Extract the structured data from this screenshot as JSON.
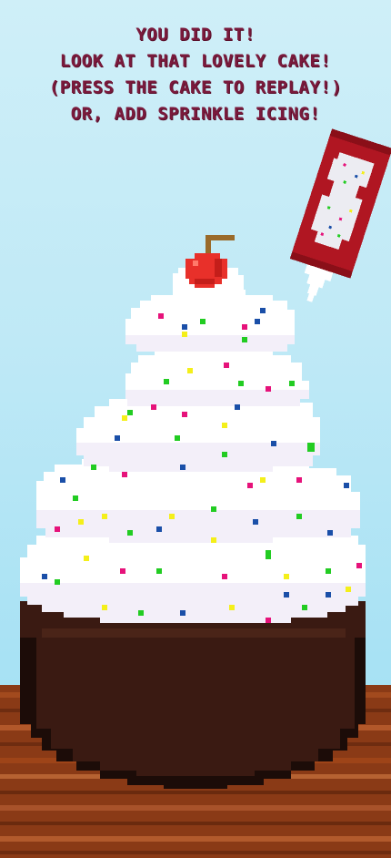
{
  "messages": {
    "line1": "You did it!",
    "line2": "Look at that lovely cake!",
    "line3": "(press the cake to replay!)",
    "line4": "Or, add sprinkle icing!"
  },
  "colors": {
    "sky_top": "#cfeff8",
    "sky_bottom": "#9fe0f4",
    "text": "#7a1a3c",
    "cake": "#3a1a12",
    "cake_dark": "#1c0c08",
    "frosting": "#ffffff",
    "frosting_shade": "#f2eef8",
    "cherry": "#e8302a",
    "stem": "#9a6a2a",
    "table": "#8a3a16",
    "tube": "#b01622",
    "sprinkle_colors": [
      "#e6127a",
      "#1a4fa8",
      "#22cc22",
      "#f4ef1a"
    ]
  },
  "icons": {
    "cake": "cake-icon",
    "cherry": "cherry-icon",
    "tube": "sprinkle-icing-tube-icon",
    "table": "wooden-table"
  }
}
